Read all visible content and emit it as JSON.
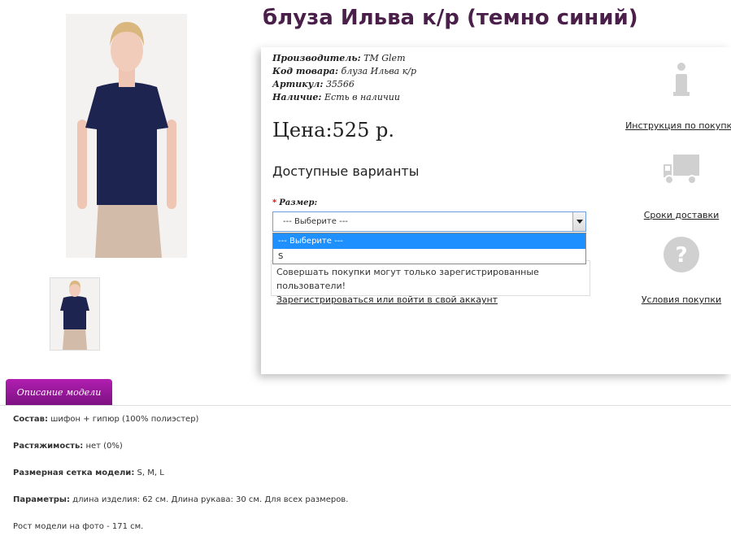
{
  "product": {
    "title": "блуза Ильва к/р (темно синий)",
    "meta": [
      {
        "key": "Производитель:",
        "value": "TM Glem"
      },
      {
        "key": "Код товара:",
        "value": "блуза Ильва к/р"
      },
      {
        "key": "Артикул:",
        "value": "35566"
      },
      {
        "key": "Наличие:",
        "value": "Есть в наличии"
      }
    ],
    "price": "Цена:525 р.",
    "variants_heading": "Доступные варианты",
    "size_label": "Размер:",
    "size_required_mark": "*",
    "size_selected": "--- Выберите ---",
    "size_options": [
      "--- Выберите ---",
      "S"
    ]
  },
  "notice": {
    "text": "Совершать покупки могут только зарегистрированные пользователи!",
    "link": "Зарегистрироваться или войти в свой аккаунт"
  },
  "side_links": [
    {
      "label": "Инструкция по покупке",
      "icon": "info-icon"
    },
    {
      "label": "Сроки доставки",
      "icon": "truck-icon"
    },
    {
      "label": "Условия покупки",
      "icon": "question-icon"
    }
  ],
  "tab": {
    "label": "Описание модели"
  },
  "description": [
    {
      "key": "Состав:",
      "value": "шифон + гипюр (100% полиэстер)"
    },
    {
      "key": "Растяжимость:",
      "value": "нет (0%)"
    },
    {
      "key": "Размерная сетка модели:",
      "value": "S, M, L"
    },
    {
      "key": "Параметры:",
      "value": "длина изделия: 62 см. Длина рукава: 30 см. Для всех размеров."
    },
    {
      "key": "",
      "value": "Рост модели на фото - 171 см."
    }
  ],
  "colors": {
    "accent": "#9a179a",
    "title": "#4a1f4a",
    "select_highlight": "#1e90ff"
  }
}
